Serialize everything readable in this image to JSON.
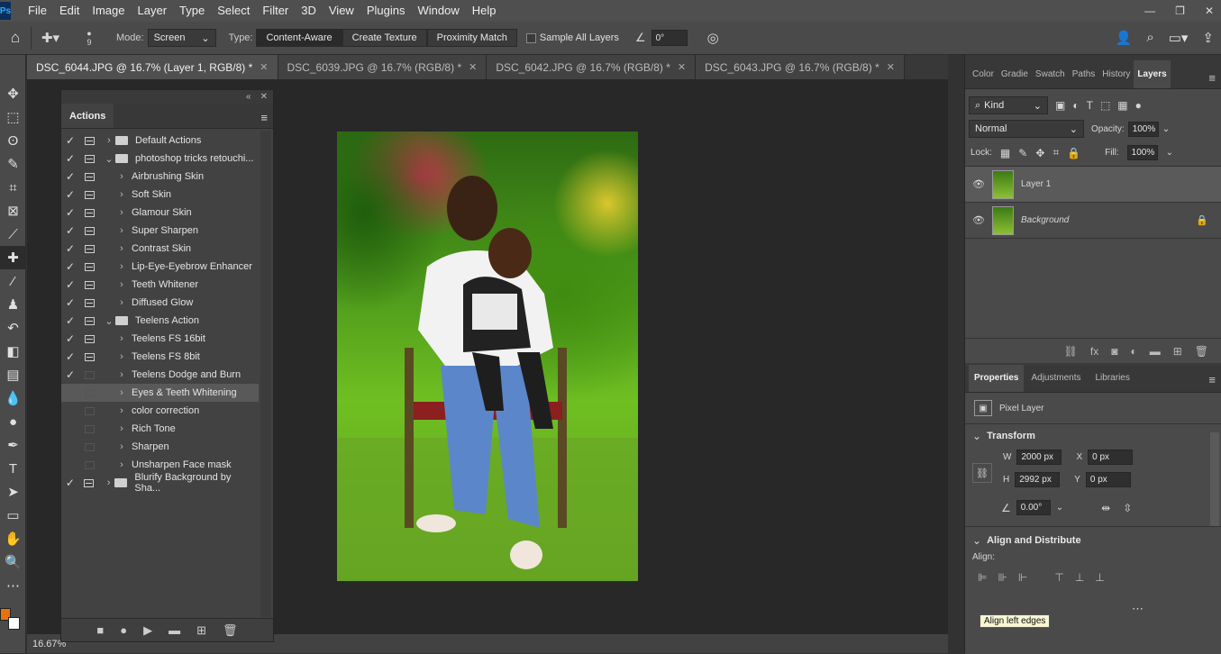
{
  "menu": {
    "items": [
      "File",
      "Edit",
      "Image",
      "Layer",
      "Type",
      "Select",
      "Filter",
      "3D",
      "View",
      "Plugins",
      "Window",
      "Help"
    ],
    "app_badge": "Ps"
  },
  "options": {
    "brush_size": "9",
    "mode_label": "Mode:",
    "mode_value": "Screen",
    "type_label": "Type:",
    "type_buttons": [
      "Content-Aware",
      "Create Texture",
      "Proximity Match"
    ],
    "sample_all_layers": "Sample All Layers",
    "angle_value": "0°"
  },
  "tabs": [
    {
      "label": "DSC_6044.JPG @ 16.7% (Layer 1, RGB/8) *"
    },
    {
      "label": "DSC_6039.JPG @ 16.7% (RGB/8) *"
    },
    {
      "label": "DSC_6042.JPG @ 16.7% (RGB/8) *"
    },
    {
      "label": "DSC_6043.JPG @ 16.7% (RGB/8) *"
    }
  ],
  "status": {
    "zoom": "16.67%"
  },
  "actions": {
    "tab": "Actions",
    "rows": [
      {
        "label": "Default Actions",
        "checked": true,
        "dialog": true,
        "folder": true,
        "open": false,
        "indent": 0
      },
      {
        "label": "photoshop tricks retouchi...",
        "checked": true,
        "dialog": true,
        "folder": true,
        "open": true,
        "indent": 0
      },
      {
        "label": "Airbrushing Skin",
        "checked": true,
        "dialog": true,
        "indent": 1
      },
      {
        "label": "Soft Skin",
        "checked": true,
        "dialog": true,
        "indent": 1
      },
      {
        "label": "Glamour Skin",
        "checked": true,
        "dialog": true,
        "indent": 1
      },
      {
        "label": "Super Sharpen",
        "checked": true,
        "dialog": true,
        "indent": 1
      },
      {
        "label": "Contrast Skin",
        "checked": true,
        "dialog": true,
        "indent": 1
      },
      {
        "label": "Lip-Eye-Eyebrow Enhancer",
        "checked": true,
        "dialog": true,
        "indent": 1
      },
      {
        "label": "Teeth Whitener",
        "checked": true,
        "dialog": true,
        "indent": 1
      },
      {
        "label": "Diffused Glow",
        "checked": true,
        "dialog": true,
        "indent": 1
      },
      {
        "label": "Teelens Action",
        "checked": true,
        "dialog": true,
        "folder": true,
        "open": true,
        "indent": 0
      },
      {
        "label": "Teelens FS 16bit",
        "checked": true,
        "dialog": true,
        "indent": 1
      },
      {
        "label": "Teelens FS 8bit",
        "checked": true,
        "dialog": true,
        "indent": 1
      },
      {
        "label": "Teelens Dodge and Burn",
        "checked": true,
        "dialog": false,
        "indent": 1
      },
      {
        "label": "Eyes & Teeth Whitening",
        "checked": false,
        "dialog": false,
        "indent": 1,
        "selected": true
      },
      {
        "label": "color correction",
        "checked": false,
        "dialog": false,
        "indent": 1
      },
      {
        "label": "Rich Tone",
        "checked": false,
        "dialog": false,
        "indent": 1
      },
      {
        "label": "Sharpen",
        "checked": false,
        "dialog": false,
        "indent": 1
      },
      {
        "label": "Unsharpen Face mask",
        "checked": false,
        "dialog": false,
        "indent": 1
      },
      {
        "label": "Blurify Background by Sha...",
        "checked": true,
        "dialog": true,
        "folder": true,
        "open": false,
        "indent": 0
      }
    ]
  },
  "layers_panel": {
    "tabs": [
      "Color",
      "Gradie",
      "Swatch",
      "Paths",
      "History",
      "Layers"
    ],
    "kind": "Kind",
    "blend": "Normal",
    "opacity_label": "Opacity:",
    "opacity": "100%",
    "lock_label": "Lock:",
    "fill_label": "Fill:",
    "fill": "100%",
    "layers": [
      {
        "name": "Layer 1",
        "selected": true
      },
      {
        "name": "Background",
        "selected": false,
        "locked": true
      }
    ]
  },
  "properties": {
    "tabs": [
      "Properties",
      "Adjustments",
      "Libraries"
    ],
    "kind": "Pixel Layer",
    "transform": "Transform",
    "w_label": "W",
    "w": "2000 px",
    "h_label": "H",
    "h": "2992 px",
    "x_label": "X",
    "x": "0 px",
    "y_label": "Y",
    "y": "0 px",
    "angle": "0.00°",
    "align_title": "Align and Distribute",
    "align_label": "Align:",
    "tooltip": "Align left edges"
  }
}
